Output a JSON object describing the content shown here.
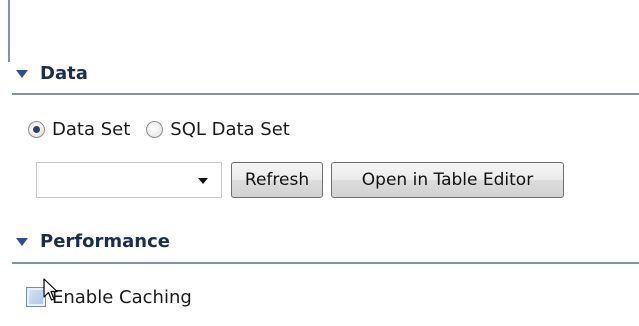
{
  "data_section": {
    "title": "Data",
    "radios": [
      {
        "label": "Data Set",
        "selected": true
      },
      {
        "label": "SQL Data Set",
        "selected": false
      }
    ],
    "dataset_combo": {
      "value": ""
    },
    "refresh_label": "Refresh",
    "open_table_editor_label": "Open in Table Editor"
  },
  "performance_section": {
    "title": "Performance",
    "enable_caching": {
      "label": "Enable Caching",
      "checked": false
    }
  },
  "icons": {
    "section_expand": "triangle-down-icon",
    "combo_arrow": "chevron-down-icon",
    "pointer": "mouse-pointer-icon"
  },
  "colors": {
    "header_text": "#1c2e4f",
    "section_rule": "#7f93b0",
    "accent": "#2f4f8a"
  }
}
